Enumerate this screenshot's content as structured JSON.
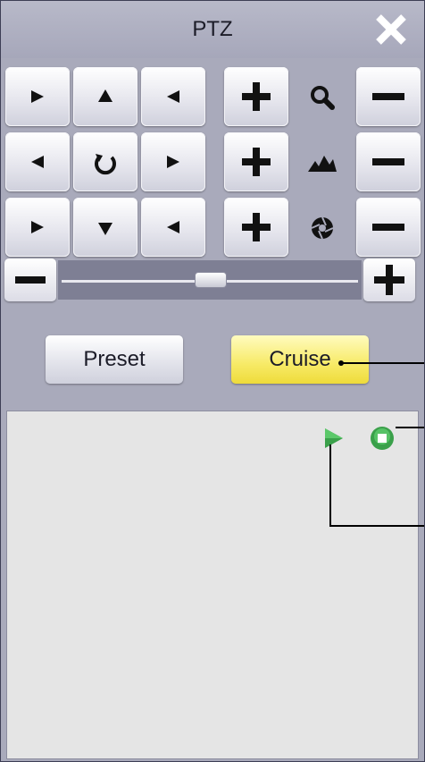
{
  "window": {
    "title": "PTZ"
  },
  "icons": {
    "close": "close-icon",
    "zoom": "magnifier-icon",
    "focus": "focus-icon",
    "iris": "iris-icon",
    "center": "rotate-icon"
  },
  "tabs": {
    "preset_label": "Preset",
    "cruise_label": "Cruise",
    "active": "Cruise"
  },
  "cruise_list": {
    "play": "play-icon",
    "stop": "stop-icon",
    "items": []
  },
  "colors": {
    "active_tab": "#f5e65a",
    "play": "#3aa04a",
    "stop": "#3aa04a"
  }
}
